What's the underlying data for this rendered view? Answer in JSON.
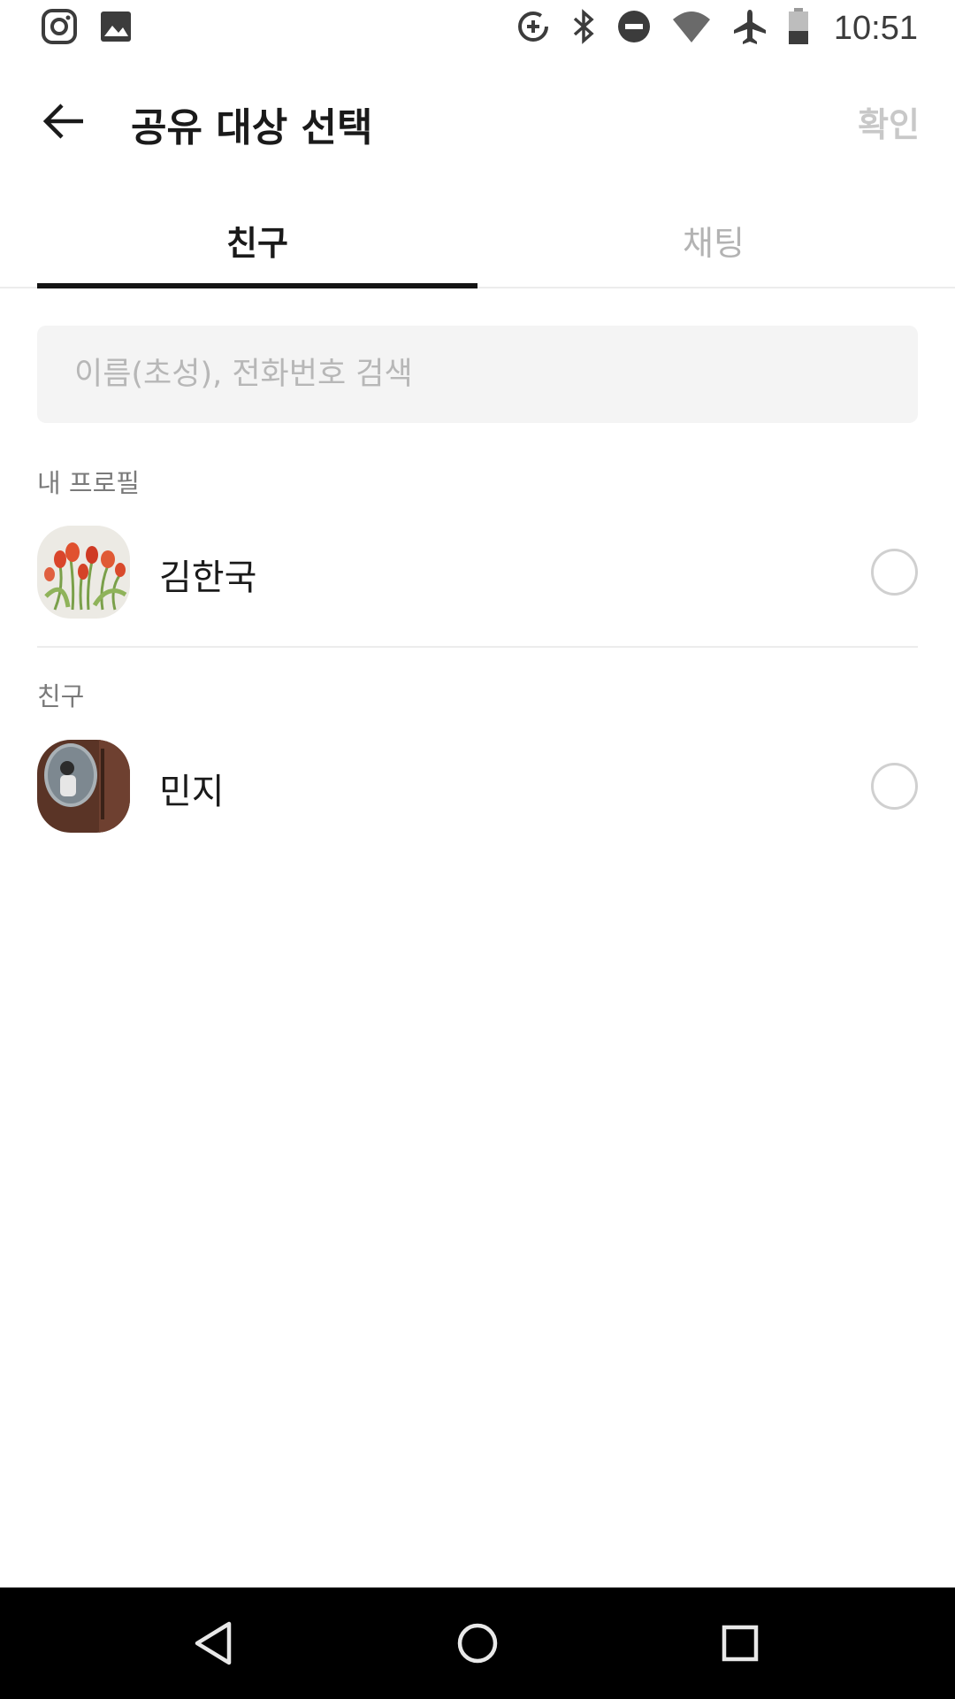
{
  "status_bar": {
    "time": "10:51",
    "left_icons": [
      "instagram-icon",
      "gallery-icon"
    ],
    "right_icons": [
      "data-saver-icon",
      "bluetooth-icon",
      "do-not-disturb-icon",
      "wifi-icon",
      "airplane-mode-icon",
      "battery-icon"
    ]
  },
  "header": {
    "title": "공유 대상 선택",
    "confirm_label": "확인"
  },
  "tabs": [
    {
      "label": "친구",
      "active": true
    },
    {
      "label": "채팅",
      "active": false
    }
  ],
  "search": {
    "placeholder": "이름(초성), 전화번호 검색",
    "value": ""
  },
  "sections": [
    {
      "header": "내 프로필",
      "items": [
        {
          "name": "김한국",
          "selected": false
        }
      ]
    },
    {
      "header": "친구",
      "items": [
        {
          "name": "민지",
          "selected": false
        }
      ]
    }
  ],
  "colors": {
    "accent_text": "#1a1a1a",
    "disabled_text": "#c8c8c8",
    "tab_indicator": "#141414",
    "search_bg": "#f4f4f4"
  }
}
